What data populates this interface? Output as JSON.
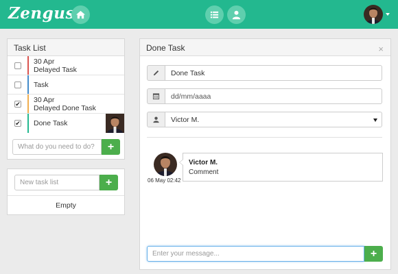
{
  "app": {
    "logo": "Zengus"
  },
  "topbar": {
    "icons": [
      "home-icon",
      "list-icon",
      "user-icon"
    ],
    "colors": {
      "bar": "#23b88f",
      "circle": "#5fcfae"
    }
  },
  "task_list": {
    "title": "Task List",
    "tasks": [
      {
        "date": "30 Apr",
        "label": "Delayed Task",
        "checked": false,
        "bar_color": "#d9534f"
      },
      {
        "date": "",
        "label": "Task",
        "checked": false,
        "bar_color": "#428bca"
      },
      {
        "date": "30 Apr",
        "label": "Delayed Done Task",
        "checked": true,
        "bar_color": "#f0ad4e"
      },
      {
        "date": "",
        "label": "Done Task",
        "checked": true,
        "bar_color": "#23b88f"
      }
    ],
    "new_task_placeholder": "What do you need to do?",
    "add_symbol": "+"
  },
  "task_lists_panel": {
    "new_list_placeholder": "New task list",
    "add_symbol": "+",
    "empty_text": "Empty"
  },
  "detail": {
    "title": "Done Task",
    "close_symbol": "×",
    "task_name": "Done Task",
    "date_placeholder": "dd/mm/aaaa",
    "assignee": "Victor M.",
    "comments": [
      {
        "author": "Victor M.",
        "text": "Comment",
        "time": "06 May 02:42"
      }
    ],
    "message_placeholder": "Enter your message...",
    "send_symbol": "+"
  }
}
